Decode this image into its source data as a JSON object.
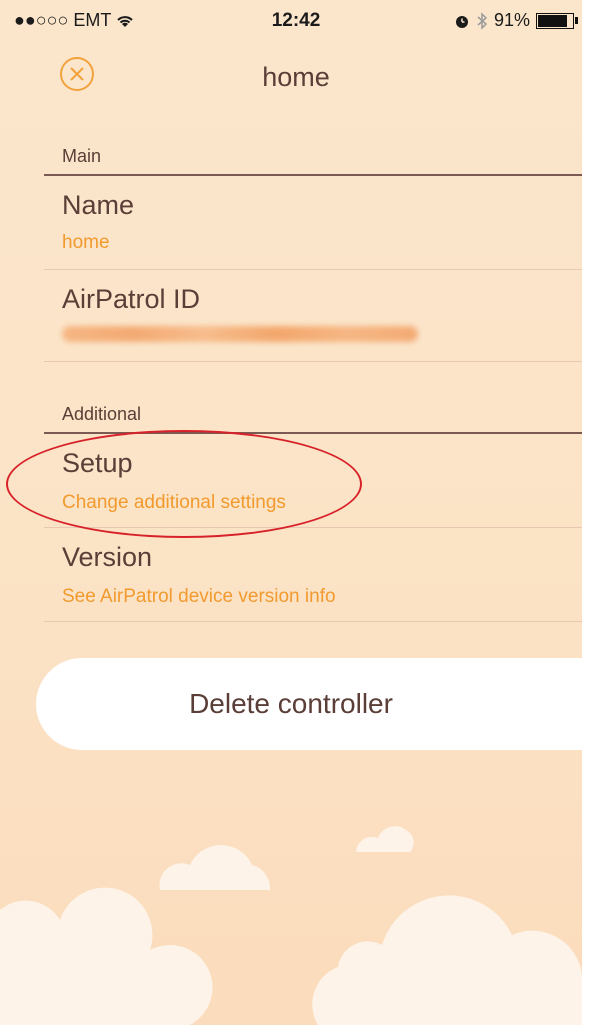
{
  "status_bar": {
    "carrier": "●●○○○ EMT",
    "time": "12:42",
    "battery_percent": "91%",
    "battery_level": 0.91
  },
  "nav": {
    "title": "home",
    "close_icon": "close-circle-icon"
  },
  "sections": {
    "main": {
      "label": "Main",
      "rows": [
        {
          "title": "Name",
          "subtitle": "home"
        },
        {
          "title": "AirPatrol ID"
        }
      ]
    },
    "additional": {
      "label": "Additional",
      "rows": [
        {
          "title": "Setup",
          "subtitle": "Change additional settings"
        },
        {
          "title": "Version",
          "subtitle": "See AirPatrol device version info"
        }
      ]
    }
  },
  "delete_button": {
    "label": "Delete controller"
  },
  "colors": {
    "accent": "#f29a2e",
    "text": "#5a3e37",
    "background": "#fbe3c6",
    "annotation": "#d8222a"
  }
}
